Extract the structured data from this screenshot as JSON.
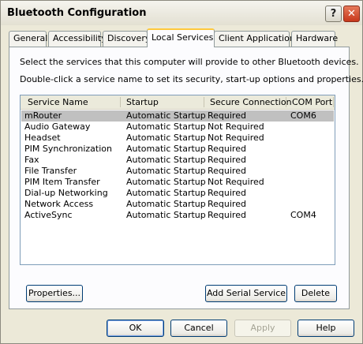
{
  "window": {
    "title": "Bluetooth Configuration"
  },
  "titlebar": {
    "help_glyph": "?",
    "close_glyph": "✕"
  },
  "tabs": [
    {
      "label": "General",
      "active": false
    },
    {
      "label": "Accessibility",
      "active": false
    },
    {
      "label": "Discovery",
      "active": false
    },
    {
      "label": "Local Services",
      "active": true
    },
    {
      "label": "Client Applications",
      "active": false
    },
    {
      "label": "Hardware",
      "active": false
    }
  ],
  "panel": {
    "intro1": "Select the services that this computer will provide to other Bluetooth devices.",
    "intro2": "Double-click a service name to set its security, start-up options and properties."
  },
  "list": {
    "columns": [
      "Service Name",
      "Startup",
      "Secure Connection",
      "COM Port"
    ],
    "selected_row": 0,
    "rows": [
      [
        "mRouter",
        "Automatic Startup",
        "Required",
        "COM6"
      ],
      [
        "Audio Gateway",
        "Automatic Startup",
        "Not Required",
        ""
      ],
      [
        "Headset",
        "Automatic Startup",
        "Not Required",
        ""
      ],
      [
        "PIM Synchronization",
        "Automatic Startup",
        "Required",
        ""
      ],
      [
        "Fax",
        "Automatic Startup",
        "Required",
        ""
      ],
      [
        "File Transfer",
        "Automatic Startup",
        "Required",
        ""
      ],
      [
        "PIM Item Transfer",
        "Automatic Startup",
        "Not Required",
        ""
      ],
      [
        "Dial-up Networking",
        "Automatic Startup",
        "Required",
        ""
      ],
      [
        "Network Access",
        "Automatic Startup",
        "Required",
        ""
      ],
      [
        "ActiveSync",
        "Automatic Startup",
        "Required",
        "COM4"
      ]
    ]
  },
  "panel_buttons": {
    "properties": "Properties...",
    "add_serial": "Add Serial Service",
    "delete": "Delete"
  },
  "dialog_buttons": {
    "ok": "OK",
    "cancel": "Cancel",
    "apply": "Apply",
    "help": "Help"
  },
  "colors": {
    "dialog_bg": "#ece9d8",
    "panel_bg": "#fcfcfe",
    "selected_row": "#c0c0c0",
    "active_tab_accent": "#ffc83c",
    "close_button": "#c7381b"
  }
}
